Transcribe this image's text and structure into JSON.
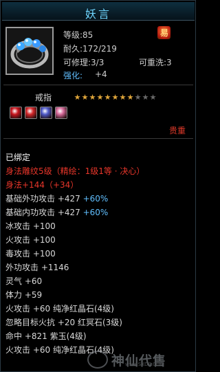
{
  "title": "妖言",
  "item": {
    "icon": "ring-with-blue-gems-icon",
    "level_label": "等级:85",
    "durability_label": "耐久:172/219",
    "repair_label": "可修理:3/3",
    "rewash_label": "可重洗:3",
    "enhance_label": "强化:",
    "enhance_value": "+4",
    "badge_char": "易"
  },
  "type_label": "戒指",
  "stars": {
    "filled": 8,
    "total": 11
  },
  "gem_slots": [
    {
      "icon": "red-gem-icon",
      "color": "#c8161f"
    },
    {
      "icon": "red-gem-icon",
      "color": "#d4272a"
    },
    {
      "icon": "purple-blue-gem-icon",
      "color": "#4f5ac8"
    },
    {
      "icon": "pink-gem-icon",
      "color": "#d66a9a"
    }
  ],
  "quality_label": "贵重",
  "bound_label": "已绑定",
  "attributes": [
    {
      "text": "身法雕纹5级（精绘：1级1等 · 决心）",
      "style": "red",
      "extra": ""
    },
    {
      "text": "身法+144（+34）",
      "style": "red",
      "extra": ""
    },
    {
      "text": "基础外功攻击 +427",
      "style": "normal",
      "extra": "+60%"
    },
    {
      "text": "基础内功攻击 +427",
      "style": "normal",
      "extra": "+60%"
    },
    {
      "text": "冰攻击 +100",
      "style": "normal",
      "extra": ""
    },
    {
      "text": "火攻击 +100",
      "style": "normal",
      "extra": ""
    },
    {
      "text": "毒攻击 +100",
      "style": "normal",
      "extra": ""
    },
    {
      "text": "外功攻击 +1146",
      "style": "normal",
      "extra": ""
    },
    {
      "text": "灵气 +60",
      "style": "normal",
      "extra": ""
    },
    {
      "text": "体力 +59",
      "style": "normal",
      "extra": ""
    },
    {
      "text": "火攻击 +60 纯净红晶石(4级)",
      "style": "normal",
      "extra": ""
    },
    {
      "text": "忽略目标火抗 +20 红冥石(3级)",
      "style": "normal",
      "extra": ""
    },
    {
      "text": "命中 +821 紫玉(4级)",
      "style": "normal",
      "extra": ""
    },
    {
      "text": "火攻击 +60 纯净红晶石(4级)",
      "style": "normal",
      "extra": ""
    }
  ],
  "watermark": {
    "text": "神仙代售",
    "url": "www.SXDS.COM"
  }
}
